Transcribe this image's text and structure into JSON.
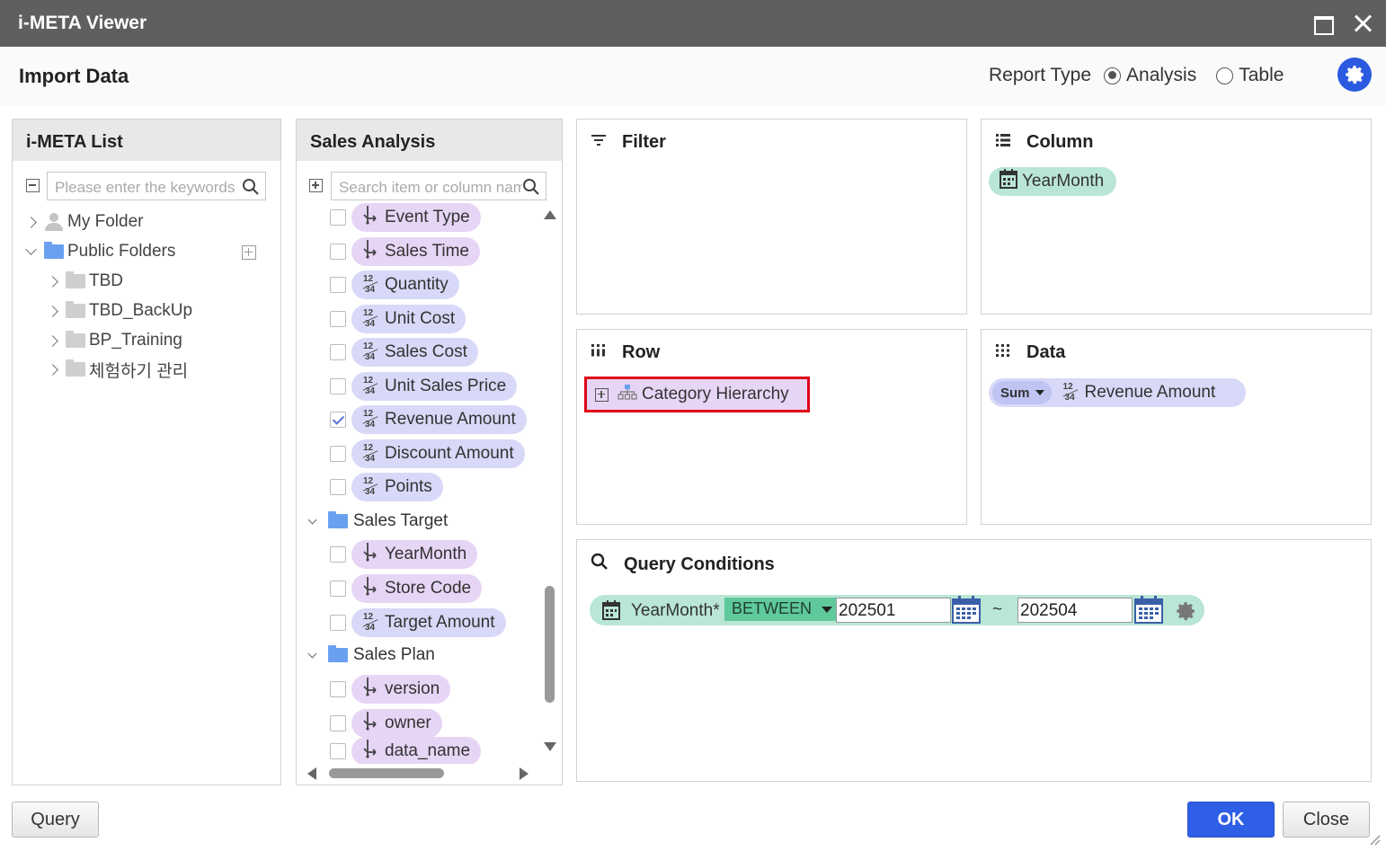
{
  "window": {
    "title": "i-META Viewer"
  },
  "header": {
    "title": "Import Data",
    "report_type_label": "Report Type",
    "options": [
      {
        "label": "Analysis",
        "selected": true
      },
      {
        "label": "Table",
        "selected": false
      }
    ]
  },
  "meta_list": {
    "title": "i-META List",
    "search_placeholder": "Please enter the keywords",
    "tree": [
      {
        "label": "My Folder"
      },
      {
        "label": "Public Folders"
      },
      {
        "label": "TBD"
      },
      {
        "label": "TBD_BackUp"
      },
      {
        "label": "BP_Training"
      },
      {
        "label": "체험하기 관리"
      }
    ]
  },
  "sales_analysis": {
    "title": "Sales Analysis",
    "search_placeholder": "Search item or column name",
    "items": [
      {
        "label": "Event Type",
        "kind": "dimension",
        "checked": false
      },
      {
        "label": "Sales Time",
        "kind": "dimension",
        "checked": false
      },
      {
        "label": "Quantity",
        "kind": "measure",
        "checked": false
      },
      {
        "label": "Unit Cost",
        "kind": "measure",
        "checked": false
      },
      {
        "label": "Sales Cost",
        "kind": "measure",
        "checked": false
      },
      {
        "label": "Unit Sales Price",
        "kind": "measure",
        "checked": false
      },
      {
        "label": "Revenue Amount",
        "kind": "measure",
        "checked": true
      },
      {
        "label": "Discount Amount",
        "kind": "measure",
        "checked": false
      },
      {
        "label": "Points",
        "kind": "measure",
        "checked": false
      }
    ],
    "group_target": "Sales Target",
    "target_items": [
      {
        "label": "YearMonth",
        "kind": "dimension"
      },
      {
        "label": "Store Code",
        "kind": "dimension"
      },
      {
        "label": "Target Amount",
        "kind": "measure"
      }
    ],
    "group_plan": "Sales Plan",
    "plan_items": [
      {
        "label": "version",
        "kind": "dimension"
      },
      {
        "label": "owner",
        "kind": "dimension"
      },
      {
        "label": "data_name",
        "kind": "dimension"
      }
    ]
  },
  "filter": {
    "title": "Filter"
  },
  "column": {
    "title": "Column",
    "item": "YearMonth"
  },
  "row": {
    "title": "Row",
    "item": "Category Hierarchy"
  },
  "data_zone": {
    "title": "Data",
    "agg": "Sum",
    "item": "Revenue Amount"
  },
  "query_conditions": {
    "title": "Query Conditions",
    "field": "YearMonth*",
    "operator": "BETWEEN",
    "from": "202501",
    "separator": "~",
    "to": "202504"
  },
  "buttons": {
    "query": "Query",
    "ok": "OK",
    "close": "Close"
  },
  "colors": {
    "accent": "#2e5fe6",
    "dimension": "#e7d5f5",
    "measure": "#d8d8f8",
    "highlight": "#e0001a"
  }
}
